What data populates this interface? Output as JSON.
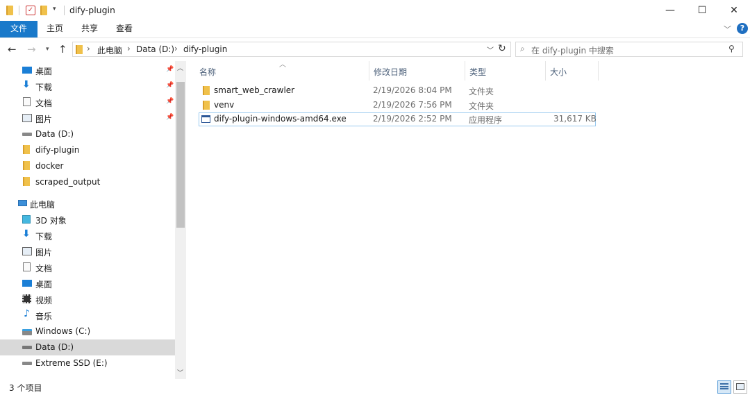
{
  "window": {
    "title": "dify-plugin",
    "minimize": "—",
    "maximize": "☐",
    "close": "✕"
  },
  "ribbon": {
    "tabs": [
      "文件",
      "主页",
      "共享",
      "查看"
    ],
    "help": "?",
    "expand_chevron": "﹀"
  },
  "address": {
    "crumbs": [
      "此电脑",
      "Data (D:)",
      "dify-plugin"
    ],
    "search_placeholder": "在 dify-plugin 中搜索"
  },
  "tree": {
    "quick_access": [
      {
        "label": "桌面",
        "icon": "desktop-icon",
        "pinned": true
      },
      {
        "label": "下载",
        "icon": "download-icon",
        "pinned": true
      },
      {
        "label": "文档",
        "icon": "documents-icon",
        "pinned": true
      },
      {
        "label": "图片",
        "icon": "pictures-icon",
        "pinned": true
      },
      {
        "label": "Data (D:)",
        "icon": "drive-icon",
        "pinned": false
      },
      {
        "label": "dify-plugin",
        "icon": "folder-icon",
        "pinned": false
      },
      {
        "label": "docker",
        "icon": "folder-icon",
        "pinned": false
      },
      {
        "label": "scraped_output",
        "icon": "folder-icon",
        "pinned": false
      }
    ],
    "this_pc_label": "此电脑",
    "this_pc": [
      {
        "label": "3D 对象",
        "icon": "3d-objects-icon"
      },
      {
        "label": "下载",
        "icon": "download-icon"
      },
      {
        "label": "图片",
        "icon": "pictures-icon"
      },
      {
        "label": "文档",
        "icon": "documents-icon"
      },
      {
        "label": "桌面",
        "icon": "desktop-icon"
      },
      {
        "label": "视频",
        "icon": "videos-icon"
      },
      {
        "label": "音乐",
        "icon": "music-icon"
      },
      {
        "label": "Windows (C:)",
        "icon": "windows-drive-icon"
      },
      {
        "label": "Data (D:)",
        "icon": "drive-icon",
        "selected": true
      },
      {
        "label": "Extreme SSD (E:)",
        "icon": "drive-icon"
      }
    ]
  },
  "list": {
    "columns": [
      "名称",
      "修改日期",
      "类型",
      "大小"
    ],
    "rows": [
      {
        "name": "smart_web_crawler",
        "date": "2/19/2026 8:04 PM",
        "type": "文件夹",
        "size": "",
        "icon": "folder-icon"
      },
      {
        "name": "venv",
        "date": "2/19/2026 7:56 PM",
        "type": "文件夹",
        "size": "",
        "icon": "folder-icon"
      },
      {
        "name": "dify-plugin-windows-amd64.exe",
        "date": "2/19/2026 2:52 PM",
        "type": "应用程序",
        "size": "31,617 KB",
        "icon": "executable-icon",
        "focused": true
      }
    ]
  },
  "status": {
    "item_count": "3 个项目"
  },
  "colors": {
    "accent": "#1979ca",
    "folder": "#e8b441",
    "selection": "#d9d9d9",
    "focus_border": "#99c9ef"
  }
}
